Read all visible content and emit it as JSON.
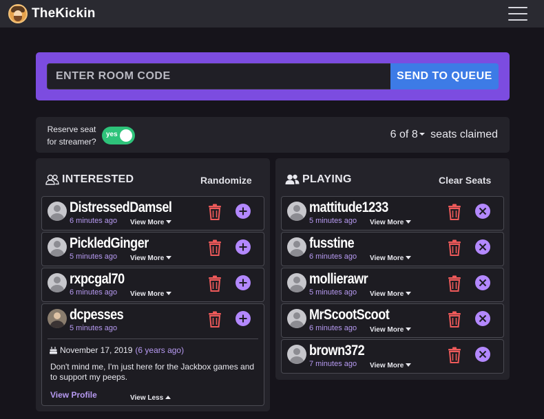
{
  "app": {
    "name": "TheKickin"
  },
  "room": {
    "placeholder": "ENTER ROOM CODE",
    "value": "",
    "send_label": "SEND TO QUEUE"
  },
  "reserve": {
    "label_line1": "Reserve seat",
    "label_line2": "for streamer?",
    "toggle_text": "yes",
    "toggle_on": true
  },
  "seats": {
    "claimed": "6",
    "of_label": "of",
    "total": "8",
    "suffix": "seats claimed"
  },
  "interested": {
    "title": "INTERESTED",
    "action_label": "Randomize",
    "users": [
      {
        "name": "DistressedDamsel",
        "ago": "6 minutes ago",
        "toggle_label": "View More"
      },
      {
        "name": "PickledGinger",
        "ago": "5 minutes ago",
        "toggle_label": "View More"
      },
      {
        "name": "rxpcgal70",
        "ago": "6 minutes ago",
        "toggle_label": "View More"
      },
      {
        "name": "dcpesses",
        "ago": "5 minutes ago",
        "toggle_label": "View Less",
        "birthday": "November 17, 2019",
        "birthday_ago": "(6 years ago)",
        "bio": "Don't mind me, I'm just here for the Jackbox games and to support my peeps.",
        "profile_link": "View Profile"
      }
    ]
  },
  "playing": {
    "title": "PLAYING",
    "action_label": "Clear Seats",
    "users": [
      {
        "name": "mattitude1233",
        "ago": "5 minutes ago",
        "toggle_label": "View More"
      },
      {
        "name": "fusstine",
        "ago": "6 minutes ago",
        "toggle_label": "View More"
      },
      {
        "name": "mollierawr",
        "ago": "5 minutes ago",
        "toggle_label": "View More"
      },
      {
        "name": "MrScootScoot",
        "ago": "6 minutes ago",
        "toggle_label": "View More"
      },
      {
        "name": "brown372",
        "ago": "7 minutes ago",
        "toggle_label": "View More"
      }
    ]
  },
  "icons": {
    "menu": "hamburger-menu-icon",
    "interested": "users-outline-icon",
    "playing": "users-filled-icon",
    "delete": "trash-icon",
    "add": "plus-circle-icon",
    "remove": "x-circle-icon",
    "birthday": "cake-icon"
  },
  "colors": {
    "background": "#16141b",
    "navbar": "#2a2a31",
    "accent_purple": "#7c4ce0",
    "send_blue": "#3d7be6",
    "toggle_green": "#2ec37a",
    "trash_red": "#ef5a5a",
    "action_lavender": "#b388ff",
    "link_lavender": "#b79af2"
  }
}
